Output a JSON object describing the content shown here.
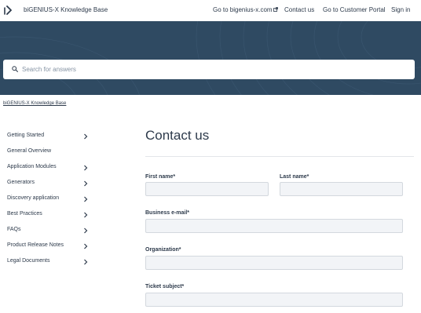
{
  "header": {
    "site_title": "biGENIUS-X Knowledge Base",
    "nav": {
      "bigenius": "Go to bigenius-x.com",
      "contact": "Contact us",
      "portal": "Go to Customer Portal",
      "signin": "Sign in"
    }
  },
  "search": {
    "placeholder": "Search for answers"
  },
  "breadcrumb": {
    "label": "biGENIUS-X Knowledge Base"
  },
  "sidebar": {
    "items": [
      {
        "label": "Getting Started",
        "chevron": true
      },
      {
        "label": "General Overview",
        "chevron": false
      },
      {
        "label": "Application Modules",
        "chevron": true
      },
      {
        "label": "Generators",
        "chevron": true
      },
      {
        "label": "Discovery application",
        "chevron": true
      },
      {
        "label": "Best Practices",
        "chevron": true
      },
      {
        "label": "FAQs",
        "chevron": true
      },
      {
        "label": "Product Release Notes",
        "chevron": true
      },
      {
        "label": "Legal Documents",
        "chevron": true
      }
    ]
  },
  "form": {
    "title": "Contact us",
    "first_name_label": "First name*",
    "first_name_value": "",
    "last_name_label": "Last name*",
    "last_name_value": "",
    "email_label": "Business e-mail*",
    "email_value": "",
    "organization_label": "Organization*",
    "organization_value": "",
    "subject_label": "Ticket subject*",
    "subject_value": ""
  },
  "colors": {
    "hero_background": "#2f4a62",
    "text": "#2d3a4b",
    "field_background": "#f2f4f7",
    "field_border": "#d3d8de"
  }
}
